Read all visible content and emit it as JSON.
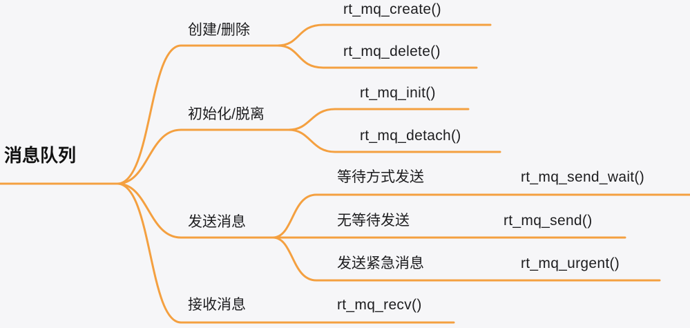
{
  "colors": {
    "branch": "#f4a040",
    "background": "#f6f6f8",
    "text": "#1d1d1f"
  },
  "mindmap": {
    "root": "消息队列",
    "branches": [
      {
        "label": "创建/删除",
        "children": [
          {
            "label": "rt_mq_create()"
          },
          {
            "label": "rt_mq_delete()"
          }
        ]
      },
      {
        "label": "初始化/脱离",
        "children": [
          {
            "label": "rt_mq_init()"
          },
          {
            "label": "rt_mq_detach()"
          }
        ]
      },
      {
        "label": "发送消息",
        "children": [
          {
            "label": "等待方式发送",
            "api": "rt_mq_send_wait()"
          },
          {
            "label": "无等待发送",
            "api": "rt_mq_send()"
          },
          {
            "label": "发送紧急消息",
            "api": "rt_mq_urgent()"
          }
        ]
      },
      {
        "label": "接收消息",
        "children": [
          {
            "label": "rt_mq_recv()"
          }
        ]
      }
    ]
  }
}
